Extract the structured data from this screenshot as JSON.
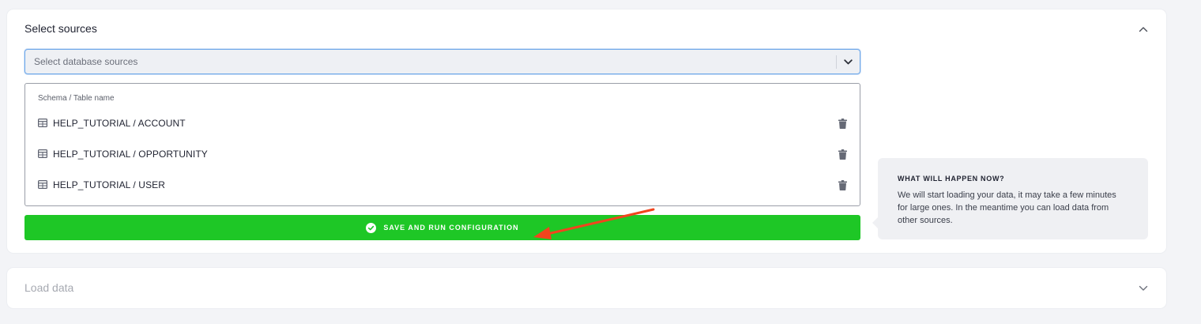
{
  "sources_panel": {
    "title": "Select sources",
    "collapse_icon": "chevron-up-icon",
    "select": {
      "placeholder": "Select database sources",
      "toggle_icon": "chevron-down-icon"
    },
    "table": {
      "header": "Schema / Table name",
      "rows": [
        {
          "label": "HELP_TUTORIAL / ACCOUNT",
          "icon": "table-icon",
          "action_icon": "trash-icon"
        },
        {
          "label": "HELP_TUTORIAL / OPPORTUNITY",
          "icon": "table-icon",
          "action_icon": "trash-icon"
        },
        {
          "label": "HELP_TUTORIAL / USER",
          "icon": "table-icon",
          "action_icon": "trash-icon"
        }
      ]
    },
    "save_button": {
      "label": "SAVE AND RUN CONFIGURATION",
      "icon": "check-circle-icon",
      "color": "#1ec726"
    },
    "annotation_arrow_color": "#f2441d",
    "info": {
      "title": "WHAT WILL HAPPEN NOW?",
      "line1": "We will start loading your data, it may take a few minutes",
      "line2": "for large ones. In the meantime you can load data from",
      "line3": "other sources."
    }
  },
  "load_panel": {
    "title": "Load data",
    "expand_icon": "chevron-down-icon"
  }
}
